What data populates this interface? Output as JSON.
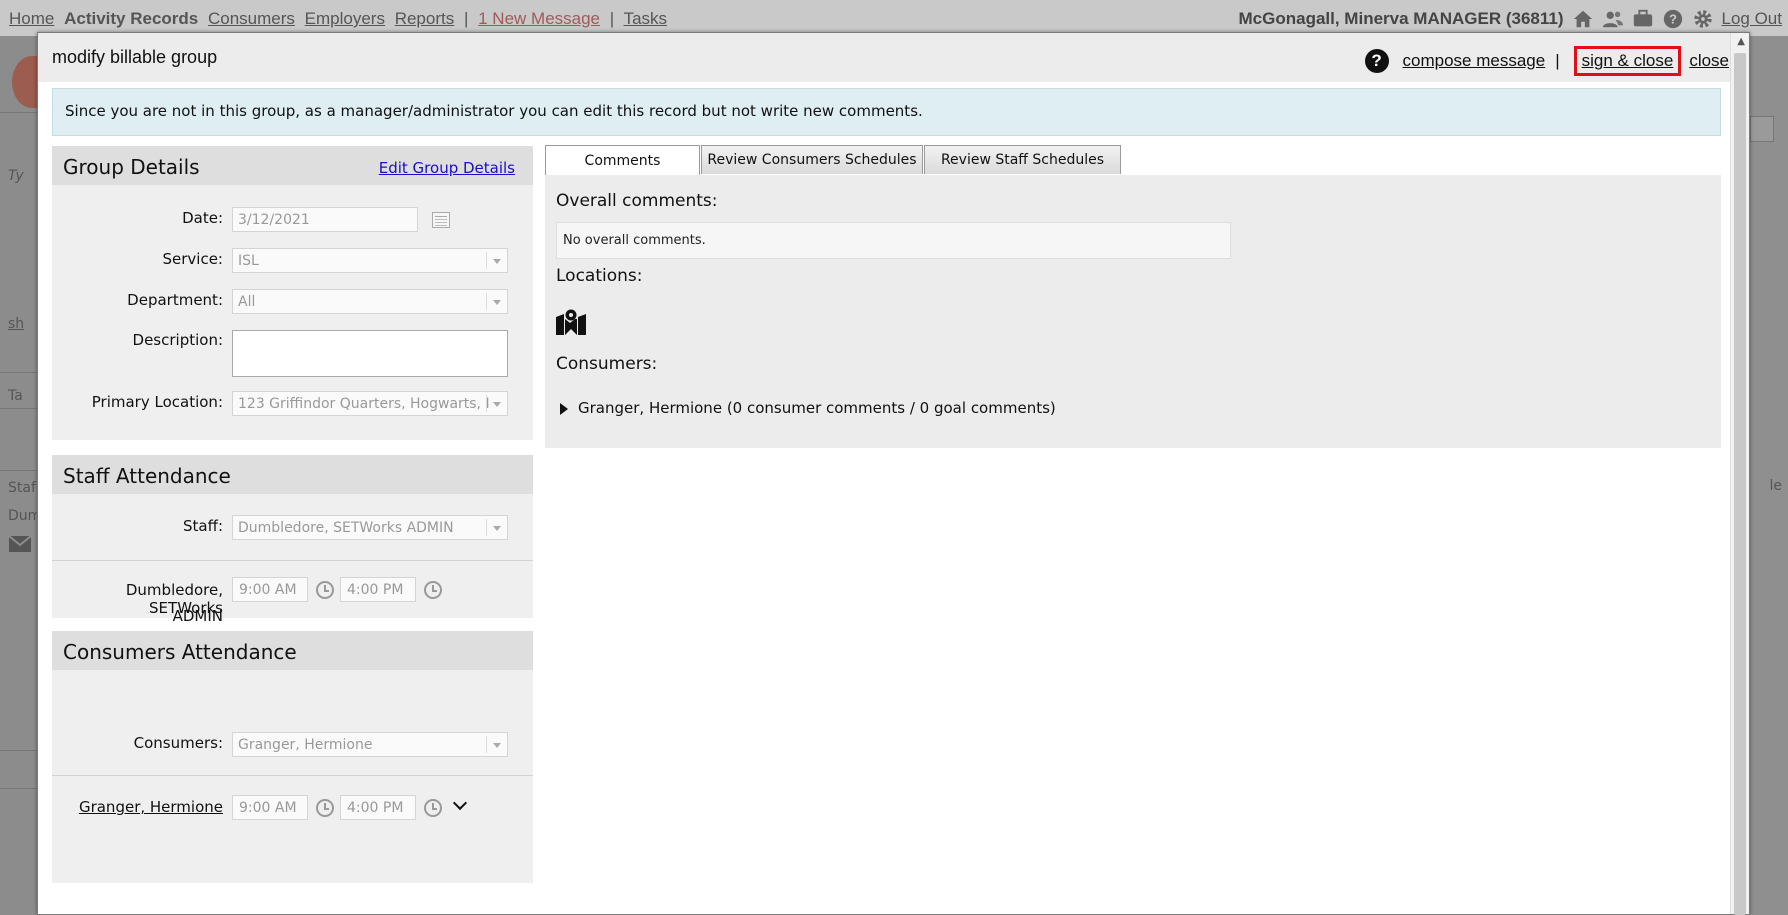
{
  "app_nav": {
    "items": [
      {
        "label": "Home",
        "style": "underline"
      },
      {
        "label": "Activity Records",
        "style": "bold"
      },
      {
        "label": "Consumers",
        "style": "underline"
      },
      {
        "label": "Employers",
        "style": "underline"
      },
      {
        "label": "Reports",
        "style": "underline"
      }
    ],
    "separator": "|",
    "new_message": "1 New Message",
    "tasks": "Tasks",
    "user": "McGonagall, Minerva MANAGER (36811)",
    "logout": "Log Out",
    "icons": [
      "home-icon",
      "users-icon",
      "briefcase-icon",
      "help-icon",
      "settings-icon"
    ]
  },
  "modal": {
    "title": "modify billable group",
    "compose": "compose message",
    "separator": "|",
    "sign_close": "sign & close",
    "close": "close",
    "help_glyph": "?",
    "notice": "Since you are not in this group, as a manager/administrator you can edit this record but not write new comments."
  },
  "group_details": {
    "heading": "Group Details",
    "edit_link": "Edit Group Details",
    "date_label": "Date:",
    "date_value": "3/12/2021",
    "service_label": "Service:",
    "service_value": "ISL",
    "department_label": "Department:",
    "department_value": "All",
    "description_label": "Description:",
    "description_value": "",
    "location_label": "Primary Location:",
    "location_value": "123 Griffindor Quarters, Hogwarts, I"
  },
  "staff_attendance": {
    "heading": "Staff Attendance",
    "staff_label": "Staff:",
    "staff_value": "Dumbledore, SETWorks ADMIN",
    "row_name_1": "Dumbledore, SETWorks",
    "row_name_2": "ADMIN",
    "start": "9:00 AM",
    "end": "4:00 PM"
  },
  "consumers_attendance": {
    "heading": "Consumers Attendance",
    "consumers_label": "Consumers:",
    "consumers_value": "Granger, Hermione",
    "row_name": "Granger, Hermione",
    "start": "9:00 AM",
    "end": "4:00 PM"
  },
  "tabs": [
    {
      "label": "Comments",
      "active": true
    },
    {
      "label": "Review Consumers Schedules",
      "active": false
    },
    {
      "label": "Review Staff Schedules",
      "active": false
    }
  ],
  "comments": {
    "overall_title": "Overall comments:",
    "overall_text": "No overall comments.",
    "locations_title": "Locations:",
    "consumers_title": "Consumers:",
    "consumer_entry": "Granger, Hermione (0 consumer comments / 0  goal comments)"
  },
  "background": {
    "left_snippets": [
      "Ty",
      "sh",
      "Ta",
      "Staf",
      "Dum"
    ],
    "right_snippet": "le"
  }
}
